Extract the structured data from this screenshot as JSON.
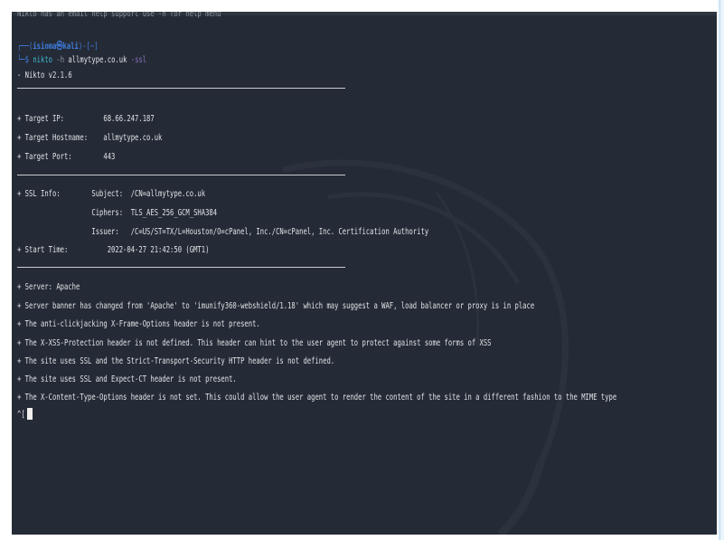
{
  "terminal": {
    "faded_top": "Nikto has an email help support use -h for help menu",
    "prompt_open": "┌──(",
    "prompt_user": "isioma㉿kali",
    "prompt_close": ")-[~]",
    "prompt_dollar": "└─$",
    "cmd_name": "nikto",
    "cmd_flag_h": "-h",
    "cmd_host": "allmytype.co.uk",
    "cmd_flag_ssl": "-ssl",
    "version": "- Nikto v2.1.6",
    "target_ip": "+ Target IP:          68.66.247.187",
    "target_hostname": "+ Target Hostname:    allmytype.co.uk",
    "target_port": "+ Target Port:        443",
    "ssl_subject": "+ SSL Info:        Subject:  /CN=allmytype.co.uk",
    "ssl_ciphers": "                   Ciphers:  TLS_AES_256_GCM_SHA384",
    "ssl_issuer": "                   Issuer:   /C=US/ST=TX/L=Houston/O=cPanel, Inc./CN=cPanel, Inc. Certification Authority",
    "start_time": "+ Start Time:          2022-04-27 21:42:50 (GMT1)",
    "findings": [
      "+ Server: Apache",
      "+ Server banner has changed from 'Apache' to 'imunify360-webshield/1.18' which may suggest a WAF, load balancer or proxy is in place",
      "+ The anti-clickjacking X-Frame-Options header is not present.",
      "+ The X-XSS-Protection header is not defined. This header can hint to the user agent to protect against some forms of XSS",
      "+ The site uses SSL and the Strict-Transport-Security HTTP header is not defined.",
      "+ The site uses SSL and Expect-CT header is not present.",
      "+ The X-Content-Type-Options header is not set. This could allow the user agent to render the content of the site in a different fashion to the MIME type"
    ],
    "interrupt": "^["
  },
  "colors": {
    "background": "#252b36",
    "prompt": "#3f7de0",
    "command": "#3fb7d0",
    "text": "#dfe3e8"
  }
}
